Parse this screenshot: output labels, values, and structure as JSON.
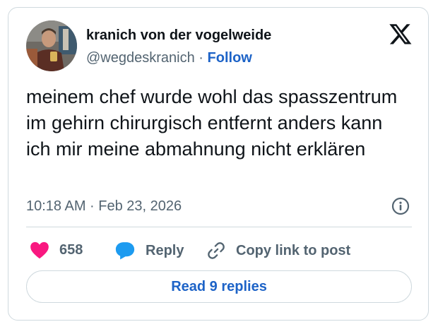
{
  "author": {
    "display_name": "kranich von der vogelweide",
    "handle": "@wegdeskranich",
    "separator": "·",
    "follow_label": "Follow"
  },
  "tweet": {
    "text": "meinem chef wurde wohl das spasszentrum im gehirn chirurgisch entfernt anders kann ich mir meine abmahnung nicht erklären",
    "timestamp": "10:18 AM · Feb 23, 2026"
  },
  "actions": {
    "like_count": "658",
    "reply_label": "Reply",
    "copy_link_label": "Copy link to post"
  },
  "footer": {
    "read_replies_label": "Read 9 replies"
  },
  "colors": {
    "accent": "#1d63c7",
    "like": "#f91880",
    "reply_icon": "#1d9bf0",
    "secondary_text": "#536471",
    "border": "#cfd9de"
  },
  "icons": [
    "x-logo-icon",
    "info-icon",
    "heart-icon",
    "reply-bubble-icon",
    "link-icon"
  ]
}
